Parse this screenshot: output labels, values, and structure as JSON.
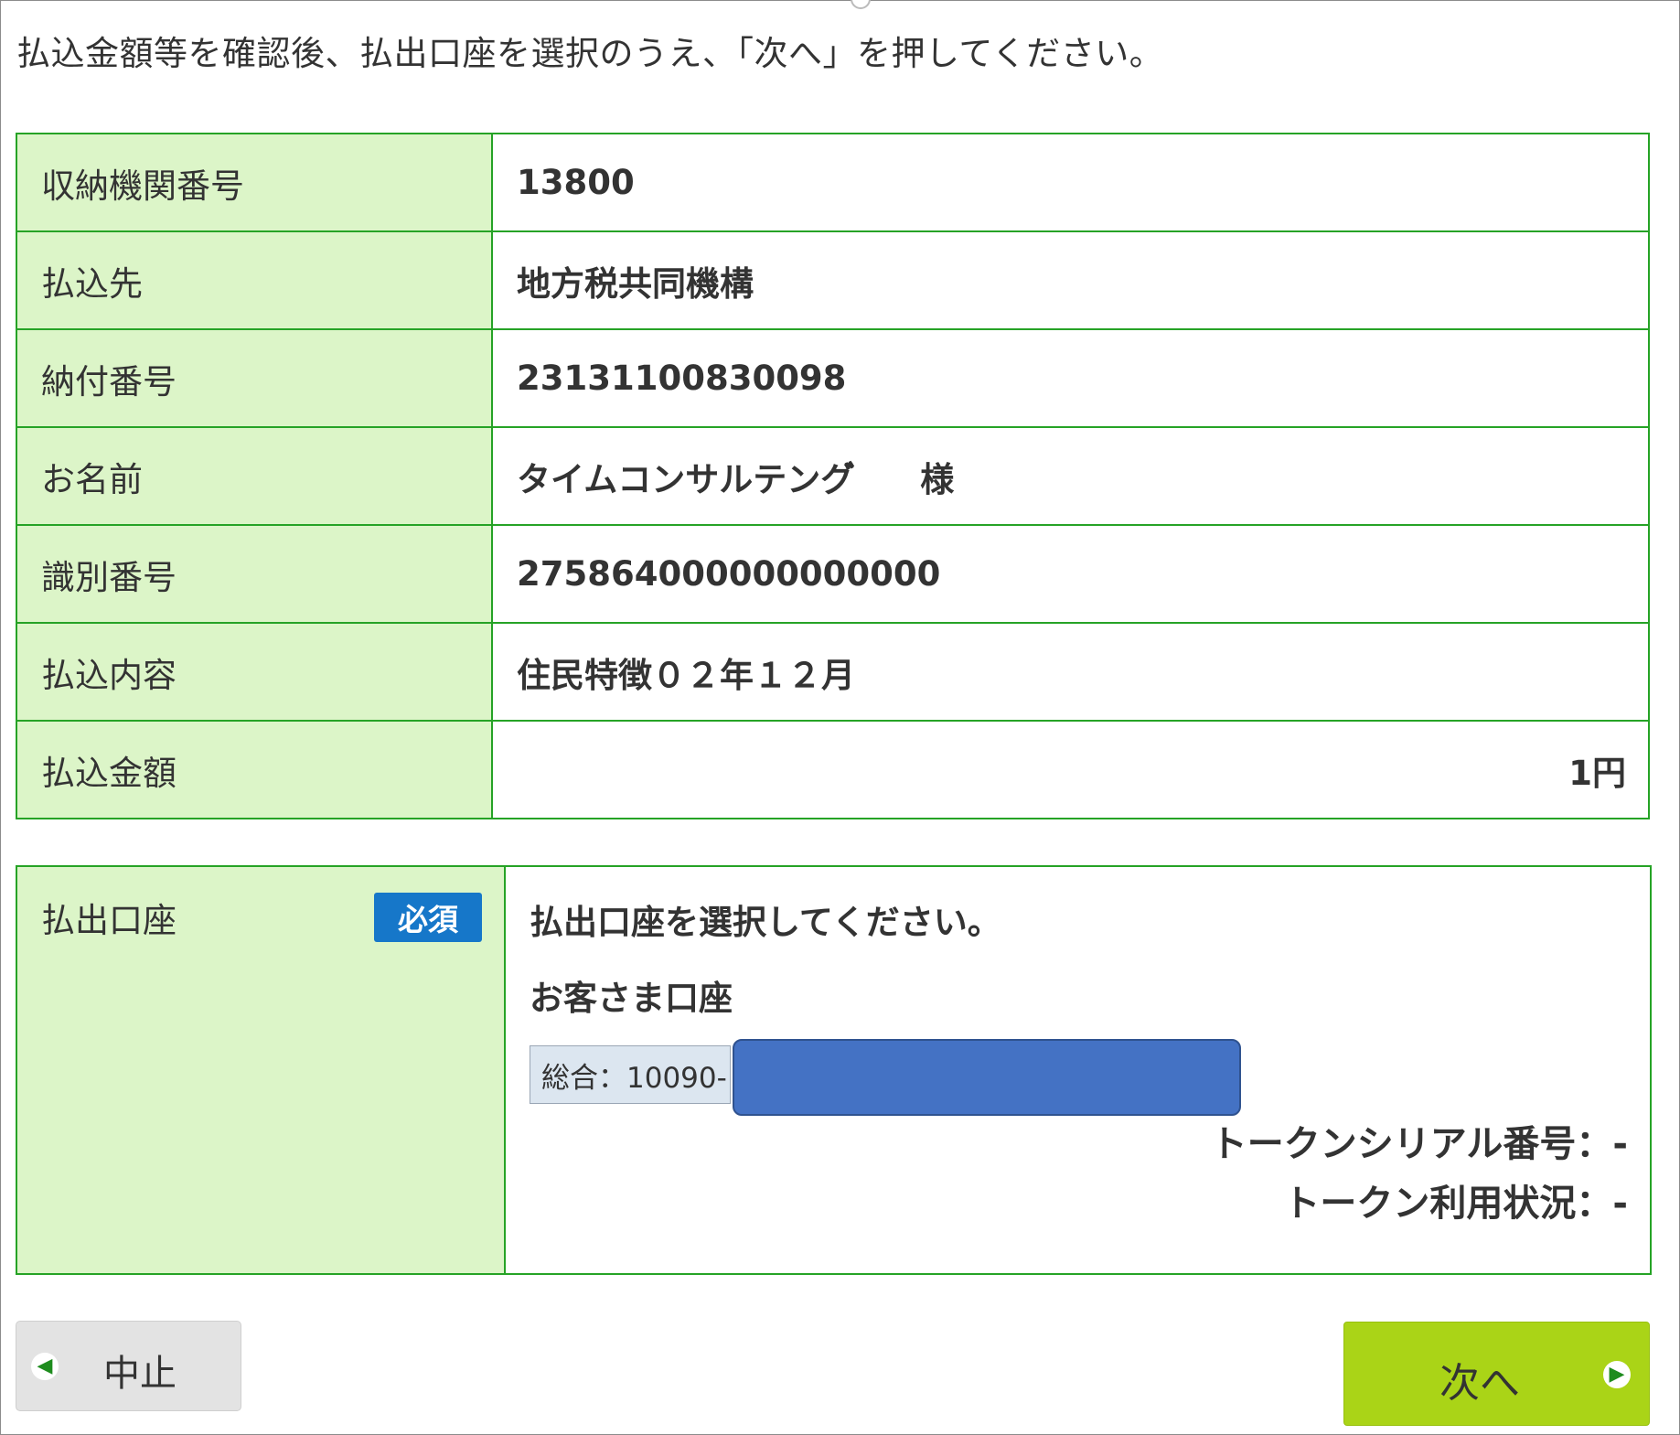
{
  "instruction": "払込金額等を確認後、払出口座を選択のうえ、「次へ」を押してください。",
  "details": {
    "rows": [
      {
        "label": "収納機関番号",
        "value": "13800"
      },
      {
        "label": "払込先",
        "value": "地方税共同機構"
      },
      {
        "label": "納付番号",
        "value": "23131100830098"
      },
      {
        "label": "お名前",
        "value": "タイムコンサルテング゙",
        "suffix": "様"
      },
      {
        "label": "識別番号",
        "value": "275864000000000000"
      },
      {
        "label": "払込内容",
        "value": "住民特徴０２年１２月"
      },
      {
        "label": "払込金額",
        "value": "1円"
      }
    ]
  },
  "account": {
    "label": "払出口座",
    "required_badge": "必須",
    "prompt": "払出口座を選択してください。",
    "heading": "お客さま口座",
    "selected_account": "総合：10090-",
    "token_serial_label": "トークンシリアル番号：",
    "token_serial_value": "-",
    "token_status_label": "トークン利用状況：",
    "token_status_value": "-"
  },
  "buttons": {
    "cancel_label": "中止",
    "cancel_icon": "arrow-left-circle-icon",
    "next_label": "次へ",
    "next_icon": "arrow-right-circle-icon"
  },
  "colors": {
    "table_border": "#26a326",
    "label_bg": "#dcf5c8",
    "badge_bg": "#1677c9",
    "next_button_bg": "#aad417",
    "cancel_button_bg": "#e3e3e3",
    "redaction": "#4472c4"
  }
}
